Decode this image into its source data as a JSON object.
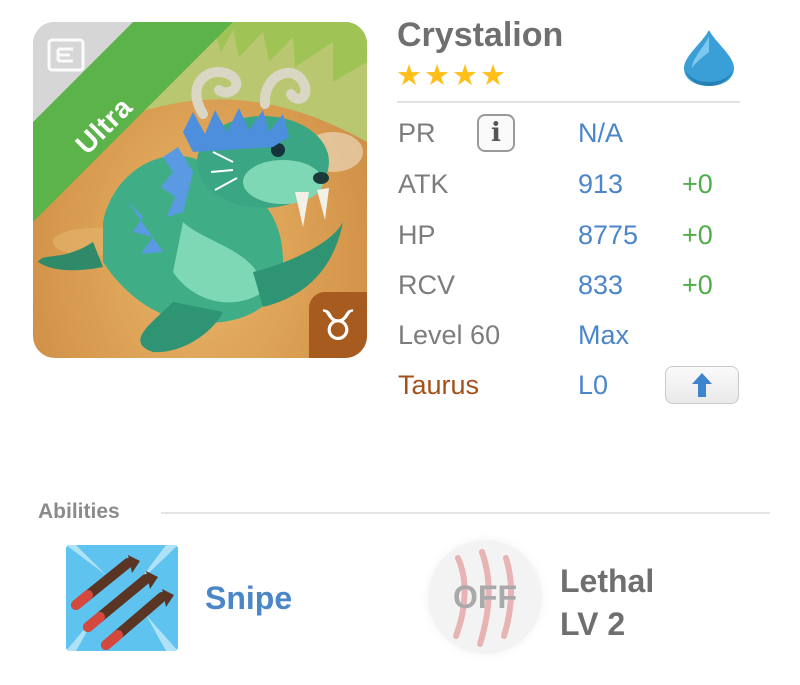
{
  "monster": {
    "name": "Crystalion",
    "rarity": "Ultra",
    "stars": "★★★★",
    "star_count": 4,
    "element_icon": "water-drop-icon",
    "zodiac_symbol": "♉"
  },
  "stats": {
    "pr": {
      "label": "PR",
      "value": "N/A"
    },
    "atk": {
      "label": "ATK",
      "value": "913",
      "bonus": "+0"
    },
    "hp": {
      "label": "HP",
      "value": "8775",
      "bonus": "+0"
    },
    "rcv": {
      "label": "RCV",
      "value": "833",
      "bonus": "+0"
    },
    "level": {
      "label": "Level 60",
      "value": "Max"
    },
    "sign": {
      "label": "Taurus",
      "value": "L0"
    }
  },
  "abilities": {
    "title": "Abilities",
    "items": [
      {
        "name": "Snipe"
      },
      {
        "name": "Lethal",
        "level": "LV 2",
        "state": "OFF"
      }
    ]
  },
  "colors": {
    "accent_blue": "#4b86c9",
    "bonus_green": "#4eae4a",
    "ribbon_green": "#5bb34a",
    "star_gold": "#ffbf18",
    "taurus_brown": "#a3501a"
  }
}
